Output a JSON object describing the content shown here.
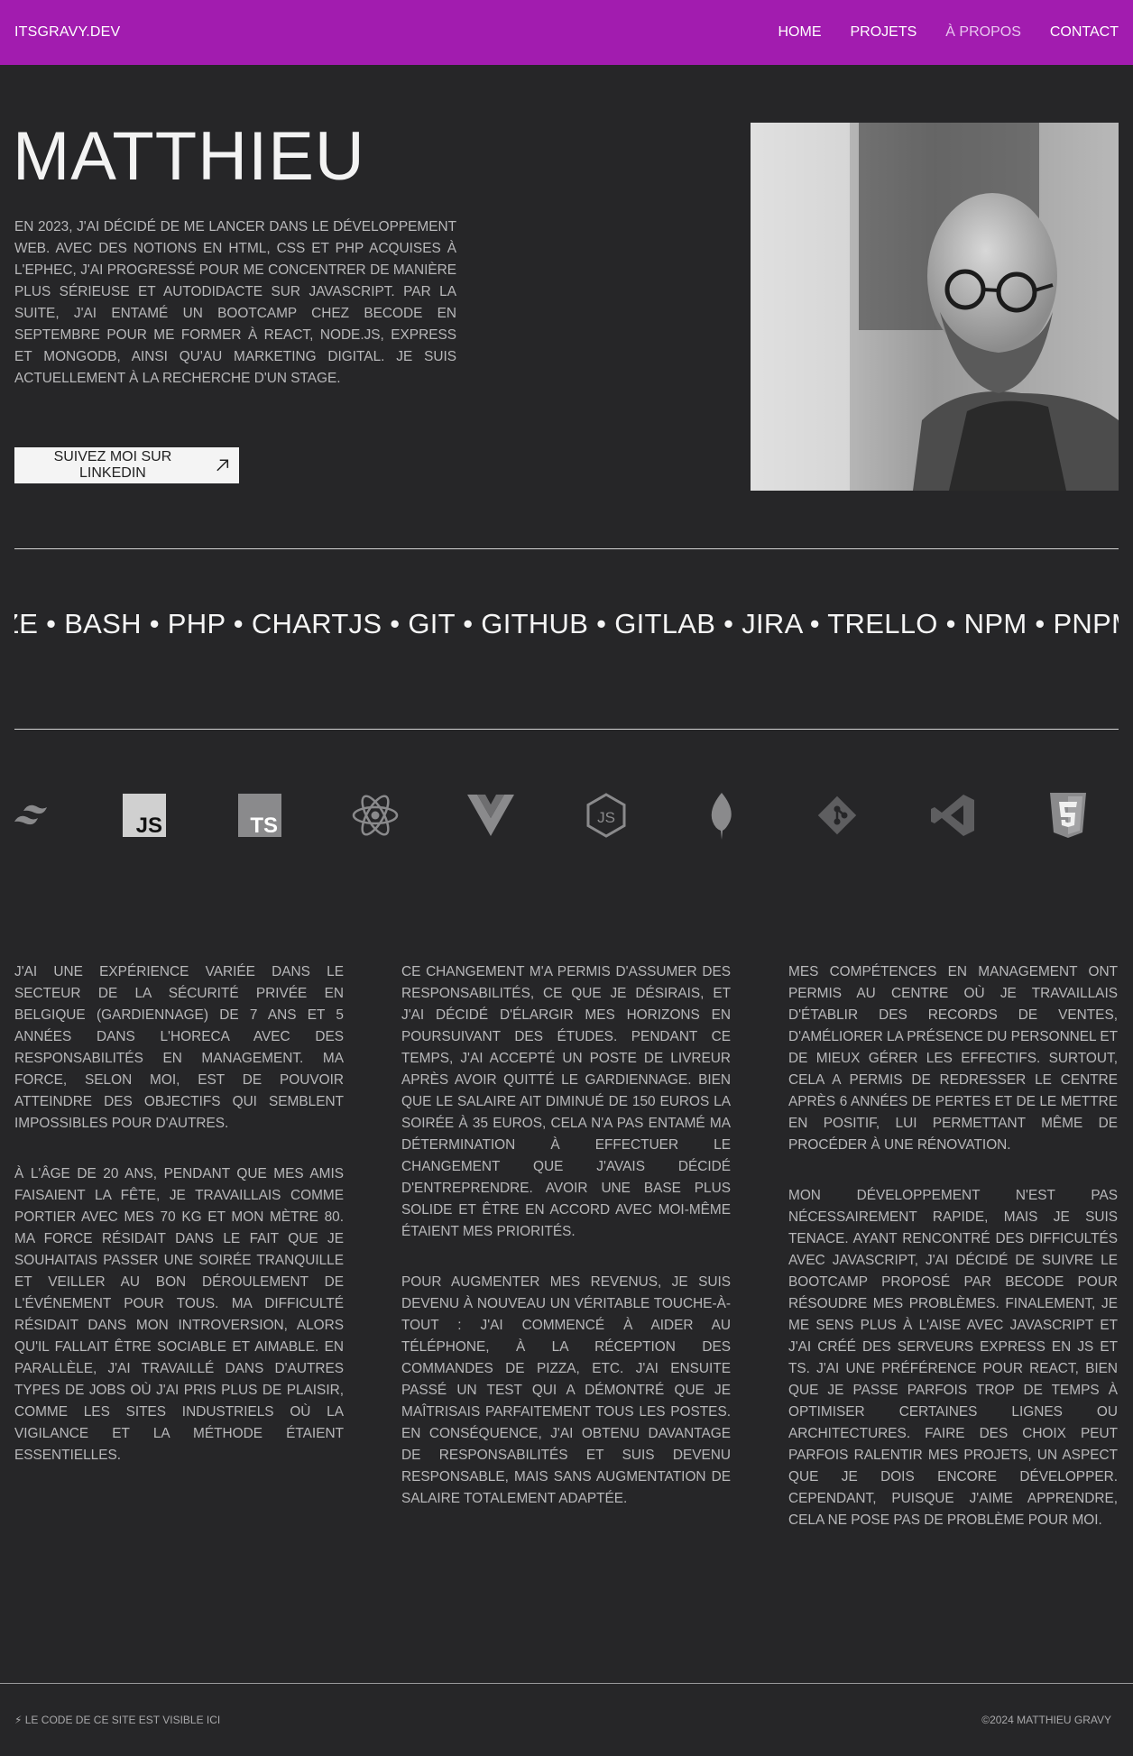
{
  "nav": {
    "brand": "ITSGRAVY.DEV",
    "links": [
      "HOME",
      "PROJETS",
      "À PROPOS",
      "CONTACT"
    ]
  },
  "hero": {
    "title": "MATTHIEU",
    "intro": "En 2023, j'ai décidé de me lancer dans le développement web. Avec des notions en HTML, CSS et PHP acquises à l'EPHEC, j'ai progressé pour me concentrer de manière plus sérieuse et autodidacte sur JavaScript. Par la suite, j'ai entamé un bootcamp chez BeCode en septembre pour me former à React, Node.js, Express et MongoDB, ainsi qu'au marketing digital. Je suis actuellement à la recherche d'un stage.",
    "linkedin_label": "SUIVEZ MOI SUR LINKEDIN"
  },
  "marquee": "ZE • BASH • PHP • CHARTJS • GIT • GITHUB • GITLAB • JIRA • TRELLO • NPM • PNPM • UBUNTU",
  "icons": [
    "tailwind-icon",
    "javascript-icon",
    "typescript-icon",
    "react-icon",
    "vue-icon",
    "nodejs-icon",
    "mongodb-icon",
    "git-icon",
    "vscode-icon",
    "html5-icon"
  ],
  "about": {
    "col1": [
      "J'ai une expérience variée dans le secteur de la sécurité privée en Belgique (gardiennage) de 7 ans et 5 années dans l'Horeca avec des responsabilités en management. Ma force, selon moi, est de pouvoir atteindre des objectifs qui semblent impossibles pour d'autres.",
      "À l'âge de 20 ans, pendant que mes amis faisaient la fête, je travaillais comme portier avec mes 70 kg et mon mètre 80. Ma force résidait dans le fait que je souhaitais passer une soirée tranquille et veiller au bon déroulement de l'événement pour tous. Ma difficulté résidait dans mon introversion, alors qu'il fallait être sociable et aimable. En parallèle, j'ai travaillé dans d'autres types de jobs où j'ai pris plus de plaisir, comme les sites industriels où la vigilance et la méthode étaient essentielles."
    ],
    "col2": [
      "Ce changement m'a permis d'assumer des responsabilités, ce que je désirais, et j'ai décidé d'élargir mes horizons en poursuivant des études. Pendant ce temps, j'ai accepté un poste de livreur après avoir quitté le gardiennage. Bien que le salaire ait diminué de 150 euros la soirée à 35 euros, cela n'a pas entamé ma détermination à effectuer le changement que j'avais décidé d'entreprendre. Avoir une base plus solide et être en accord avec moi-même étaient mes priorités.",
      "Pour augmenter mes revenus, je suis devenu à nouveau un véritable touche-à-tout : j'ai commencé à aider au téléphone, à la réception des commandes de pizza, etc. J'ai ensuite passé un test qui a démontré que je maîtrisais parfaitement tous les postes. En conséquence, j'ai obtenu davantage de responsabilités et suis devenu responsable, mais sans augmentation de salaire totalement adaptée."
    ],
    "col3": [
      "Mes compétences en management ont permis au centre où je travaillais d'établir des records de ventes, d'améliorer la présence du personnel et de mieux gérer les effectifs. Surtout, cela a permis de redresser le centre après 6 années de pertes et de le mettre en positif, lui permettant même de procéder à une rénovation.",
      "Mon développement n'est pas nécessairement rapide, mais je suis tenace. Ayant rencontré des difficultés avec JavaScript, j'ai décidé de suivre le bootcamp proposé par BeCode pour résoudre mes problèmes. Finalement, je me sens plus à l'aise avec JavaScript et j'ai créé des serveurs Express en JS et TS. J'ai une préférence pour React, bien que je passe parfois trop de temps à optimiser certaines lignes ou architectures. Faire des choix peut parfois ralentir mes projets, un aspect que je dois encore développer. Cependant, puisque j'aime apprendre, cela ne pose pas de problème pour moi."
    ]
  },
  "footer": {
    "left": "⚡ LE CODE DE CE SITE EST VISIBLE ICI",
    "right": "©2024  MATTHIEU GRAVY"
  }
}
